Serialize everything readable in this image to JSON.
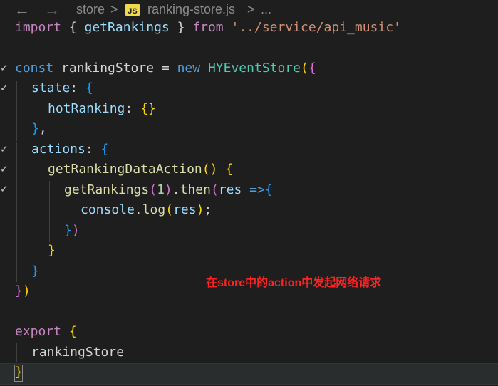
{
  "breadcrumb": {
    "back_icon": "arrow-left-icon",
    "forward_icon": "arrow-right-icon",
    "folder": "store",
    "separator": ">",
    "file_icon_label": "JS",
    "file": "ranking-store.js",
    "more": "..."
  },
  "code": {
    "l1": {
      "a": "import",
      "b": " { ",
      "c": "getRankings",
      "d": " } ",
      "e": "from",
      "f": " ",
      "g": "'../service/api_music'"
    },
    "l3": {
      "a": "const",
      "b": " rankingStore = ",
      "c": "new",
      "d": " ",
      "e": "HYEventStore",
      "f": "(",
      "g": "{"
    },
    "l4": {
      "a": "state",
      "b": ": ",
      "c": "{"
    },
    "l5": {
      "a": "hotRanking",
      "b": ": ",
      "c": "{}"
    },
    "l6": {
      "a": "}",
      "b": ","
    },
    "l7": {
      "a": "actions",
      "b": ": ",
      "c": "{"
    },
    "l8": {
      "a": "getRankingDataAction",
      "b": "()",
      "c": " {"
    },
    "l9": {
      "a": "getRankings",
      "b": "(",
      "c": "1",
      "d": ")",
      "e": ".",
      "f": "then",
      "g": "(",
      "h": "res",
      "i": " =>",
      "j": "{"
    },
    "l10": {
      "a": "console",
      "b": ".",
      "c": "log",
      "d": "(",
      "e": "res",
      "f": ")",
      "g": ";"
    },
    "l11": {
      "a": "}",
      "b": ")"
    },
    "l12": {
      "a": "}"
    },
    "l13": {
      "a": "}"
    },
    "l14": {
      "a": "}",
      "b": ")"
    },
    "l16": {
      "a": "export",
      "b": " ",
      "c": "{"
    },
    "l17": {
      "a": "rankingStore"
    },
    "l18": {
      "a": "}"
    }
  },
  "annotation": "在store中的action中发起网络请求",
  "colors": {
    "background": "#1e1e1e",
    "keyword": "#569cd6",
    "import_keyword": "#c586c0",
    "function": "#dcdcaa",
    "string": "#ce9178",
    "number": "#b5cea8",
    "bracket_gold": "#ffd700",
    "bracket_purple": "#da70d6",
    "bracket_blue": "#179fff",
    "annotation": "#ff2222"
  }
}
